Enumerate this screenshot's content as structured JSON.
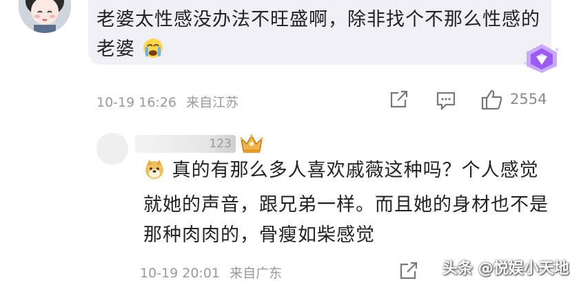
{
  "comment": {
    "text": "老婆太性感没办法不旺盛啊，除非找个不那么性感的老婆",
    "emoji": "crying-face-emoji",
    "timestamp": "10-19 16:26",
    "location": "来自江苏",
    "like_count": "2554",
    "badge": "purple-gem-badge"
  },
  "reply": {
    "username_fragment": "123",
    "badge": "crown-badge",
    "emoji": "doge-emoji",
    "text": "真的有那么多人喜欢戚薇这种吗？个人感觉就她的声音，跟兄弟一样。而且她的身材也不是那种肉肉的，骨瘦如柴感觉",
    "timestamp": "10-19 20:01",
    "location": "来自广东"
  },
  "watermark": "头条 @悦娱小天地",
  "colors": {
    "bubble": "#f2f0f7",
    "meta": "#9a9a9a",
    "text": "#222222"
  }
}
